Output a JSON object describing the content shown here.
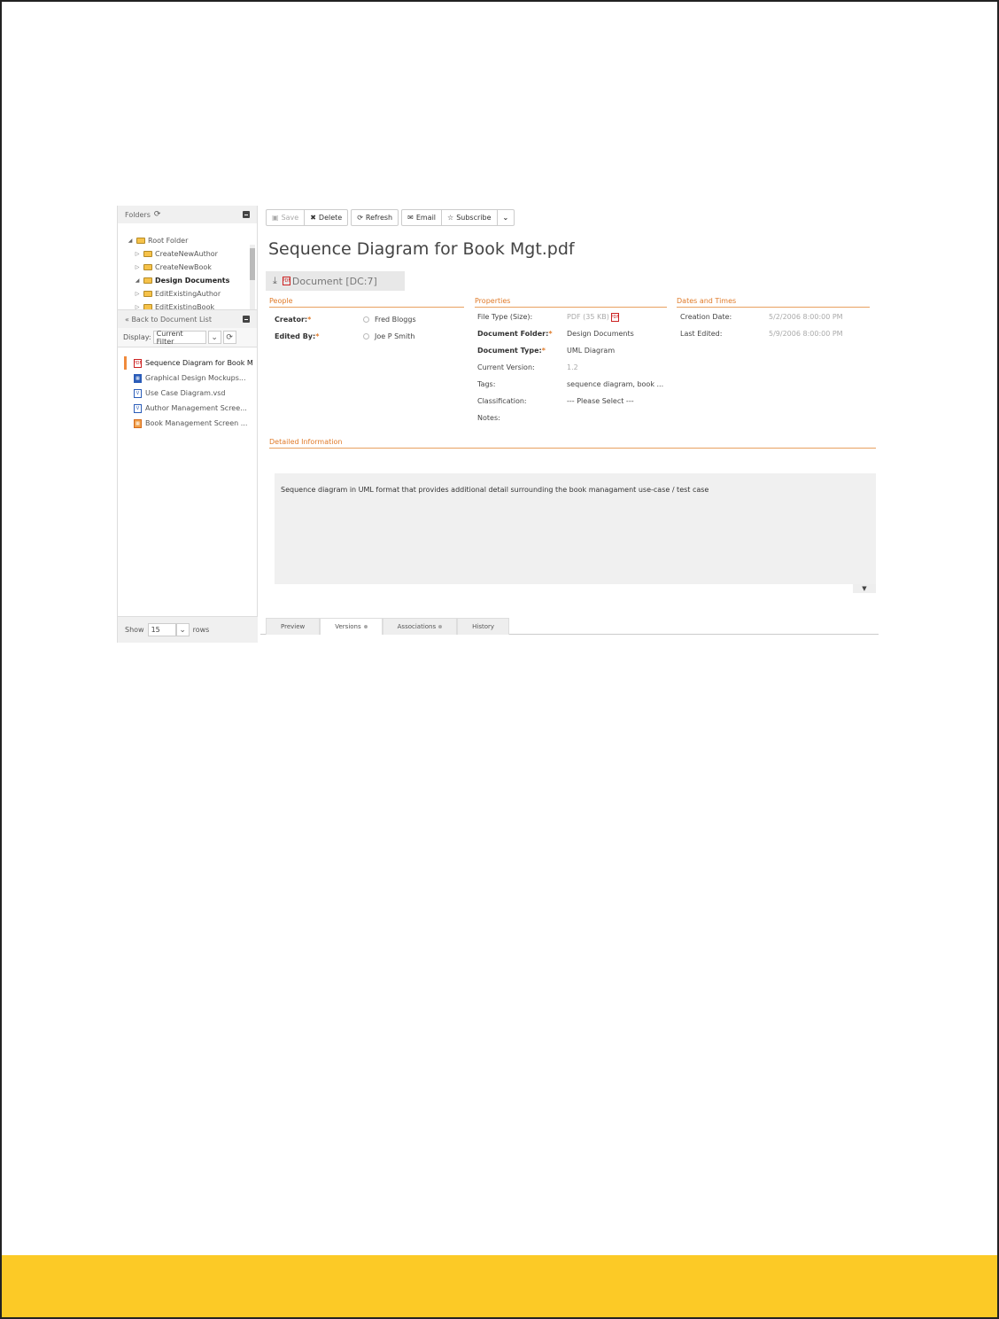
{
  "sidebar": {
    "folders_label": "Folders",
    "tree": [
      {
        "label": "Root Folder",
        "toggle": "◢",
        "bold": false
      },
      {
        "label": "CreateNewAuthor",
        "toggle": "▷",
        "bold": false
      },
      {
        "label": "CreateNewBook",
        "toggle": "▷",
        "bold": false
      },
      {
        "label": "Design Documents",
        "toggle": "◢",
        "bold": true
      },
      {
        "label": "EditExistingAuthor",
        "toggle": "▷",
        "bold": false
      },
      {
        "label": "EditExistingBook",
        "toggle": "▷",
        "bold": false
      }
    ],
    "back_label": "« Back to Document List",
    "display_label": "Display:",
    "display_value": "Current Filter",
    "documents": [
      {
        "label": "Sequence Diagram for Book M",
        "icon": "pdf-icon",
        "active": true
      },
      {
        "label": "Graphical Design Mockups...",
        "icon": "image-icon",
        "active": false
      },
      {
        "label": "Use Case Diagram.vsd",
        "icon": "visio-icon",
        "active": false
      },
      {
        "label": "Author Management Scree...",
        "icon": "visio-icon",
        "active": false
      },
      {
        "label": "Book Management Screen ...",
        "icon": "image-icon",
        "active": false
      }
    ],
    "show_label": "Show",
    "rows_value": "15",
    "rows_label": "rows"
  },
  "toolbar": {
    "save": "Save",
    "delete": "Delete",
    "refresh": "Refresh",
    "email": "Email",
    "subscribe": "Subscribe"
  },
  "document": {
    "title": "Sequence Diagram for Book Mgt.pdf",
    "badge": "Document [DC:7]"
  },
  "people": {
    "heading": "People",
    "creator_label": "Creator:",
    "creator_value": "Fred Bloggs",
    "edited_label": "Edited By:",
    "edited_value": "Joe P Smith"
  },
  "properties": {
    "heading": "Properties",
    "rows": [
      {
        "label": "File Type (Size):",
        "value": "PDF  (35 KB)",
        "bold": false,
        "req": false,
        "muted": true
      },
      {
        "label": "Document Folder:",
        "value": "Design Documents",
        "bold": true,
        "req": true,
        "muted": false
      },
      {
        "label": "Document Type:",
        "value": "UML Diagram",
        "bold": true,
        "req": true,
        "muted": false
      },
      {
        "label": "Current Version:",
        "value": "1.2",
        "bold": false,
        "req": false,
        "muted": true
      },
      {
        "label": "Tags:",
        "value": "sequence diagram, book ...",
        "bold": false,
        "req": false,
        "muted": false
      },
      {
        "label": "Classification:",
        "value": "--- Please Select ---",
        "bold": false,
        "req": false,
        "muted": false
      },
      {
        "label": "Notes:",
        "value": "",
        "bold": false,
        "req": false,
        "muted": false
      }
    ]
  },
  "dates": {
    "heading": "Dates and Times",
    "creation_label": "Creation Date:",
    "creation_value": "5/2/2006 8:00:00 PM",
    "edited_label": "Last Edited:",
    "edited_value": "5/9/2006 8:00:00 PM"
  },
  "detailed": {
    "heading": "Detailed Information",
    "text": "Sequence diagram in UML format that provides additional detail surrounding the book managament use-case / test case"
  },
  "tabs": [
    {
      "label": "Preview",
      "dot": false,
      "active": false
    },
    {
      "label": "Versions",
      "dot": true,
      "active": true
    },
    {
      "label": "Associations",
      "dot": true,
      "active": false
    },
    {
      "label": "History",
      "dot": false,
      "active": false
    }
  ],
  "colors": {
    "accent": "#e07b2a",
    "footer": "#fcca26",
    "active_marker": "#f08a3c"
  }
}
